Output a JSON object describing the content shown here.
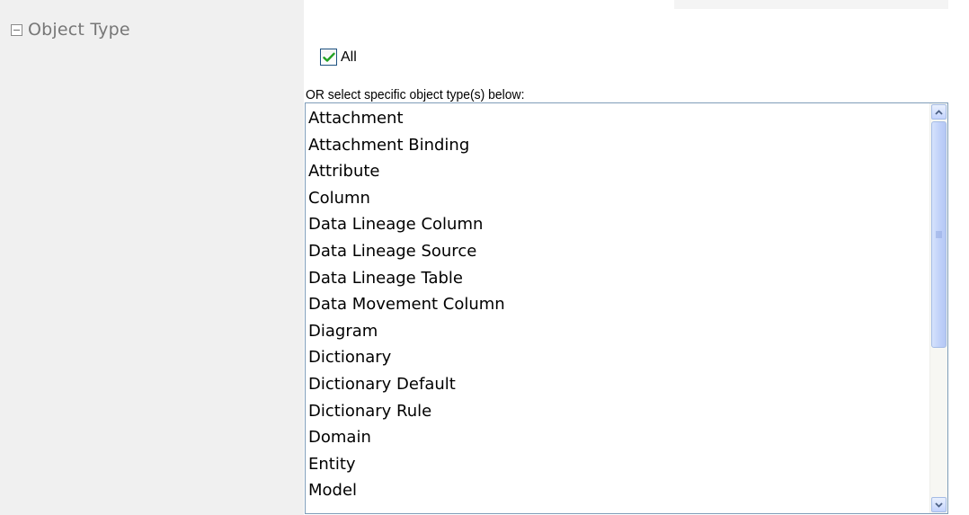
{
  "section": {
    "title": "Object Type",
    "collapse_icon": "minus-box-icon"
  },
  "all_checkbox": {
    "label": "All",
    "checked": true,
    "check_color": "#21a121"
  },
  "or_label": "OR select specific object type(s) below:",
  "object_types": [
    "Attachment",
    "Attachment Binding",
    "Attribute",
    "Column",
    "Data Lineage Column",
    "Data Lineage Source",
    "Data Lineage Table",
    "Data Movement Column",
    "Diagram",
    "Dictionary",
    "Dictionary Default",
    "Dictionary Rule",
    "Domain",
    "Entity",
    "Model"
  ],
  "scrollbar": {
    "up_icon": "scroll-up-arrow-icon",
    "down_icon": "scroll-down-arrow-icon",
    "accent": "#a5bce5"
  }
}
